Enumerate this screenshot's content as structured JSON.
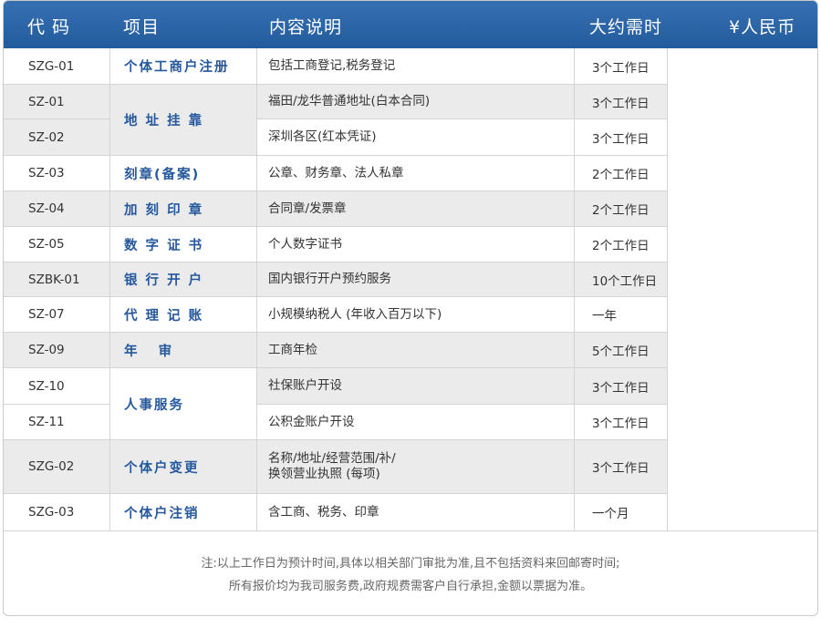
{
  "header": {
    "code": "代 码",
    "item": "项目",
    "desc": "内容说明",
    "time": "大约需时",
    "price": "¥人民币"
  },
  "rows": [
    {
      "code": "SZG-01",
      "time": "3个工作日",
      "desc": "包括工商登记,税务登记"
    },
    {
      "code": "SZ-01",
      "time": "3个工作日",
      "desc": "福田/龙华普通地址(白本合同)"
    },
    {
      "code": "SZ-02",
      "time": "3个工作日",
      "desc": "深圳各区(红本凭证)"
    },
    {
      "code": "SZ-03",
      "time": "2个工作日",
      "desc": "公章、财务章、法人私章"
    },
    {
      "code": "SZ-04",
      "time": "2个工作日",
      "desc": "合同章/发票章"
    },
    {
      "code": "SZ-05",
      "time": "2个工作日",
      "desc": "个人数字证书"
    },
    {
      "code": "SZBK-01",
      "time": "10个工作日",
      "desc": "国内银行开户预约服务"
    },
    {
      "code": "SZ-07",
      "time": "一年",
      "desc": "小规模纳税人 (年收入百万以下)"
    },
    {
      "code": "SZ-09",
      "time": "5个工作日",
      "desc": "工商年检"
    },
    {
      "code": "SZ-10",
      "time": "3个工作日",
      "desc": "社保账户开设"
    },
    {
      "code": "SZ-11",
      "time": "3个工作日",
      "desc": "公积金账户开设"
    },
    {
      "code": "SZG-02",
      "time": "3个工作日",
      "desc_line1": "名称/地址/经营范围/补/",
      "desc_line2": "换领营业执照 (每项)"
    },
    {
      "code": "SZG-03",
      "time": "一个月",
      "desc": "含工商、税务、印章"
    }
  ],
  "items": {
    "getihu_zhuce": "个体工商户注册",
    "dizhi_guakao": "地 址 挂 靠",
    "kezhang_beian": "刻章(备案)",
    "jiake_yinzhang": "加 刻 印 章",
    "shuzi_zhengshu": "数 字 证 书",
    "yinhang_kaihu": "银 行 开 户",
    "daili_jizhang": "代 理 记 账",
    "nianshen": "年   审",
    "renshi_fuwu": "人事服务",
    "getihu_biangeng": "个体户变更",
    "getihu_zhuxiao": "个体户注销"
  },
  "note": {
    "line1": "注:以上工作日为预计时间,具体以相关部门审批为准,且不包括资料来回邮寄时间;",
    "line2": "所有报价均为我司服务费,政府规费需客户自行承担,金额以票据为准。"
  },
  "colors": {
    "header_bg": "#2a64a6",
    "header_text": "#ffffff",
    "item_text": "#25589c",
    "alt_row_bg": "#ebebeb"
  }
}
